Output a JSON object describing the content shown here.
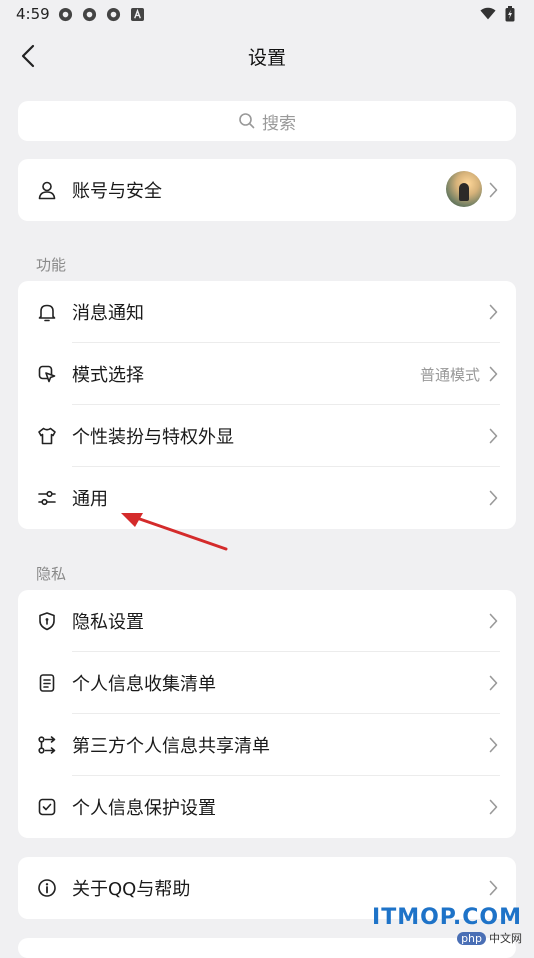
{
  "status_bar": {
    "time": "4:59"
  },
  "header": {
    "title": "设置"
  },
  "search": {
    "placeholder": "搜索"
  },
  "account": {
    "label": "账号与安全"
  },
  "sections": {
    "features": {
      "title": "功能",
      "items": [
        {
          "label": "消息通知",
          "icon": "bell-icon"
        },
        {
          "label": "模式选择",
          "icon": "mode-icon",
          "value": "普通模式"
        },
        {
          "label": "个性装扮与特权外显",
          "icon": "tshirt-icon"
        },
        {
          "label": "通用",
          "icon": "sliders-icon"
        }
      ]
    },
    "privacy": {
      "title": "隐私",
      "items": [
        {
          "label": "隐私设置",
          "icon": "shield-icon"
        },
        {
          "label": "个人信息收集清单",
          "icon": "document-icon"
        },
        {
          "label": "第三方个人信息共享清单",
          "icon": "share-list-icon"
        },
        {
          "label": "个人信息保护设置",
          "icon": "check-box-icon"
        }
      ]
    }
  },
  "about": {
    "label": "关于QQ与帮助"
  },
  "watermark": {
    "main": "ITMOP.COM",
    "php": "php",
    "sub": "中文网"
  },
  "colors": {
    "background": "#f0f0f2",
    "card": "#ffffff",
    "arrow": "#d42b2b",
    "watermark": "#1e73c8"
  }
}
